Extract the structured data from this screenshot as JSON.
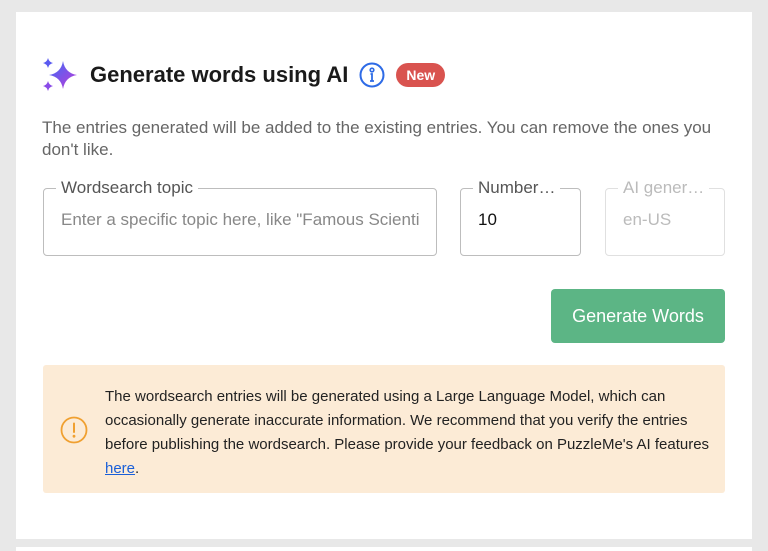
{
  "header": {
    "title": "Generate words using AI",
    "badge": "New"
  },
  "description": "The entries generated will be added to the existing entries. You can remove the ones you don't like.",
  "fields": {
    "topic": {
      "label": "Wordsearch topic",
      "value": "",
      "placeholder": "Enter a specific topic here, like \"Famous Scientists\""
    },
    "number": {
      "label": "Number…",
      "value": "10"
    },
    "locale": {
      "label": "AI gener…",
      "value": "en-US"
    }
  },
  "generate_button": "Generate Words",
  "notice": {
    "text": "The wordsearch entries will be generated using a Large Language Model, which can occasionally generate inaccurate information. We recommend that you verify the entries before publishing the wordsearch. Please provide your feedback on PuzzleMe's AI features ",
    "link_text": "here",
    "suffix": "."
  },
  "colors": {
    "accent": "#5cb585",
    "badge": "#d9534f",
    "notice_bg": "#fcebd6",
    "warning": "#f0a030",
    "info": "#2e6be6",
    "sparkle_start": "#3b6cf6",
    "sparkle_end": "#c03ad8"
  },
  "icons": [
    "sparkle-icon",
    "info-icon",
    "warning-icon"
  ]
}
